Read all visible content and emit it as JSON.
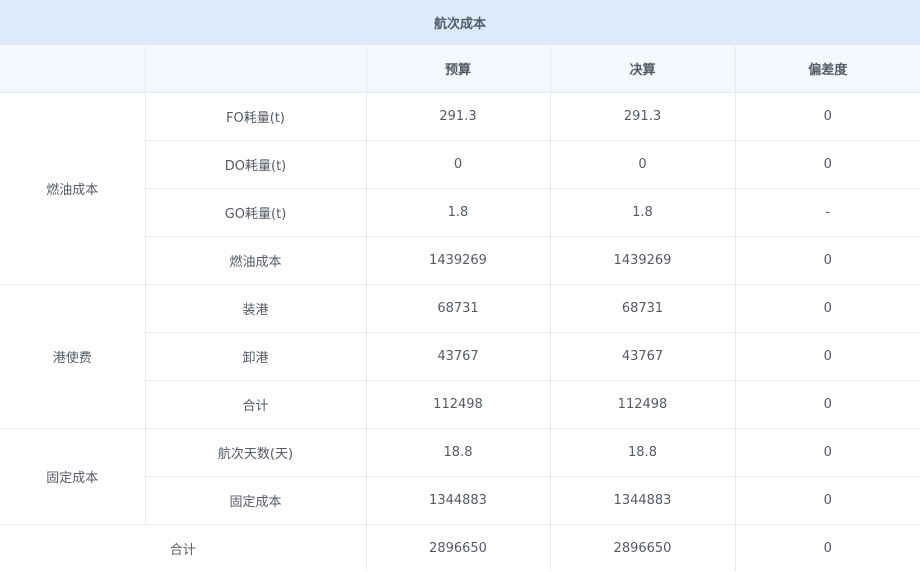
{
  "title": "航次成本",
  "header": {
    "col0": "",
    "col1": "",
    "budget": "预算",
    "final": "决算",
    "deviation": "偏差度"
  },
  "groups": [
    {
      "name": "燃油成本",
      "rows": [
        {
          "item": "FO耗量(t)",
          "budget": "291.3",
          "final": "291.3",
          "deviation": "0"
        },
        {
          "item": "DO耗量(t)",
          "budget": "0",
          "final": "0",
          "deviation": "0"
        },
        {
          "item": "GO耗量(t)",
          "budget": "1.8",
          "final": "1.8",
          "deviation": "-"
        },
        {
          "item": "燃油成本",
          "budget": "1439269",
          "final": "1439269",
          "deviation": "0"
        }
      ]
    },
    {
      "name": "港使费",
      "rows": [
        {
          "item": "装港",
          "budget": "68731",
          "final": "68731",
          "deviation": "0"
        },
        {
          "item": "卸港",
          "budget": "43767",
          "final": "43767",
          "deviation": "0"
        },
        {
          "item": "合计",
          "budget": "112498",
          "final": "112498",
          "deviation": "0"
        }
      ]
    },
    {
      "name": "固定成本",
      "rows": [
        {
          "item": "航次天数(天)",
          "budget": "18.8",
          "final": "18.8",
          "deviation": "0"
        },
        {
          "item": "固定成本",
          "budget": "1344883",
          "final": "1344883",
          "deviation": "0"
        }
      ]
    }
  ],
  "total": {
    "label": "合计",
    "budget": "2896650",
    "final": "2896650",
    "deviation": "0"
  }
}
